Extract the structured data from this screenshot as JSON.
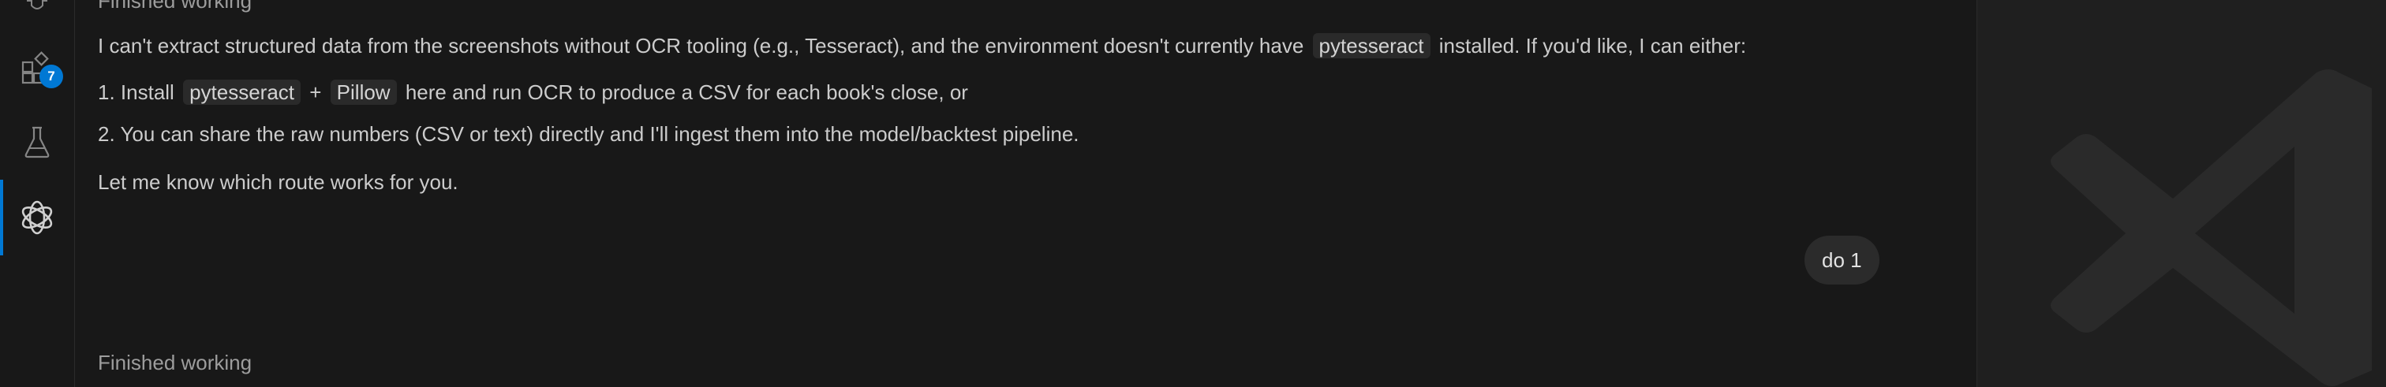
{
  "activity_bar": {
    "extensions_badge": "7"
  },
  "chat": {
    "status_top": "Finished working",
    "assistant_message": {
      "intro_before": "I can't extract structured data from the screenshots without OCR tooling (e.g., Tesseract), and the environment doesn't currently have",
      "intro_code": "pytesseract",
      "intro_after": "installed. If you'd like, I can either:",
      "item1_prefix": "1. Install",
      "item1_code1": "pytesseract",
      "item1_plus": "+",
      "item1_code2": "Pillow",
      "item1_suffix": "here and run OCR to produce a CSV for each book's close, or",
      "item2": "2. You can share the raw numbers (CSV or text) directly and I'll ingest them into the model/backtest pipeline.",
      "closing": "Let me know which route works for you."
    },
    "user_message": "do 1",
    "status_bottom": "Finished working"
  },
  "colors": {
    "accent": "#0078d4",
    "background": "#181818",
    "text": "#cccccc",
    "muted": "#9d9d9d"
  }
}
